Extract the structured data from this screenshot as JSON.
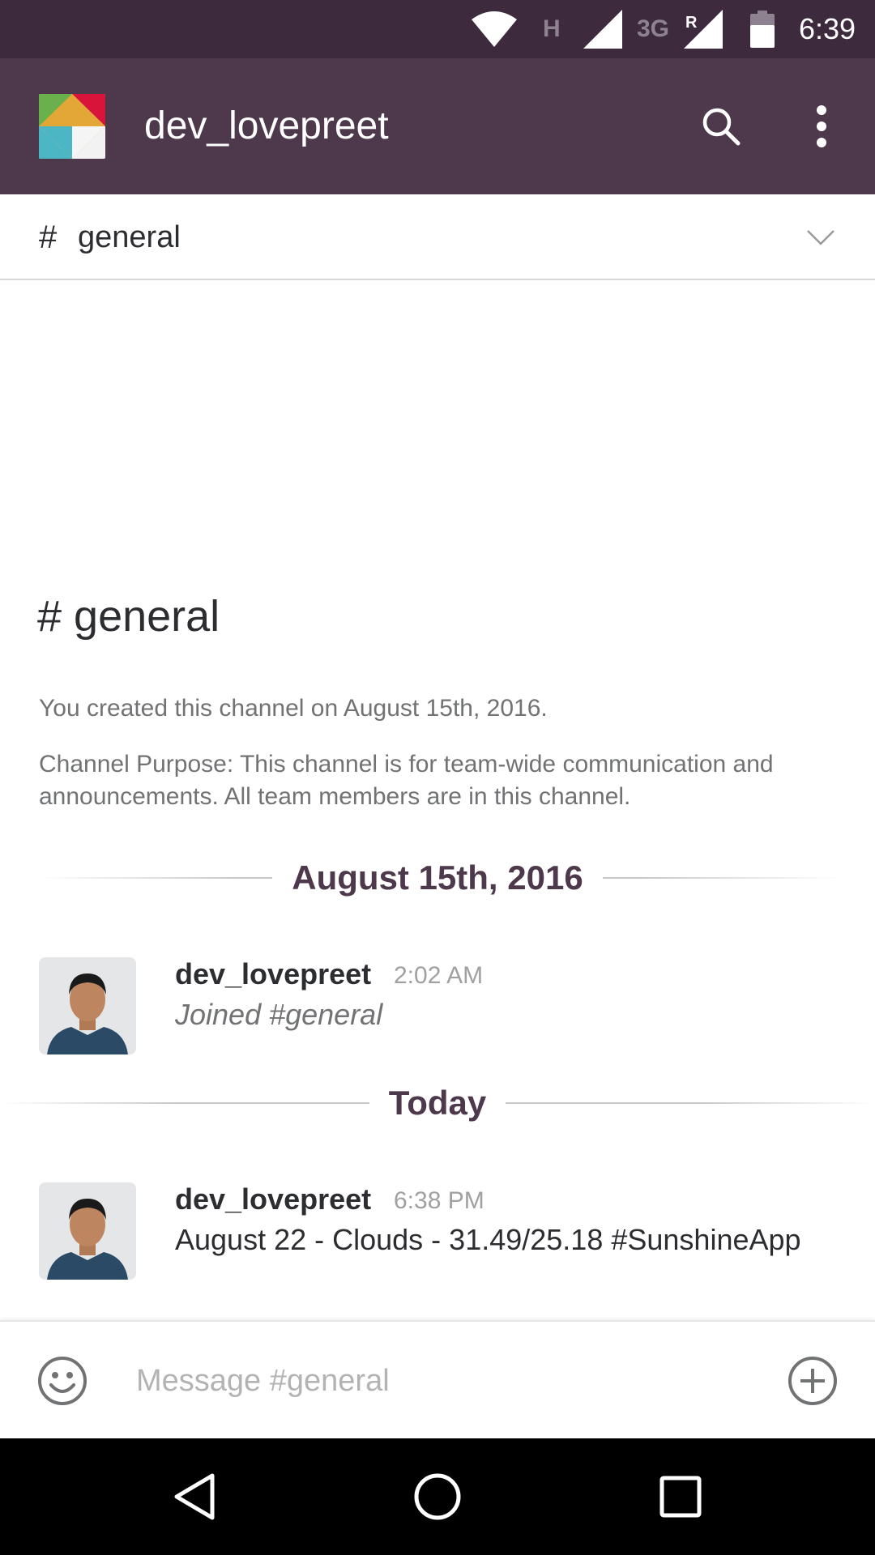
{
  "status_bar": {
    "network_h": "H",
    "network_3g": "3G",
    "roaming": "R",
    "time": "6:39",
    "icons": [
      "wifi-icon",
      "signal-icon",
      "roaming-signal-icon",
      "battery-icon"
    ]
  },
  "app_bar": {
    "team_name": "dev_lovepreet",
    "icons": [
      "team-logo",
      "search-icon",
      "overflow-menu-icon"
    ]
  },
  "channel_header": {
    "hash": "#",
    "name": "general",
    "icon": "chevron-down-icon"
  },
  "intro": {
    "title": "# general",
    "created": "You created this channel on August 15th, 2016.",
    "purpose": "Channel Purpose: This channel is for team-wide communication and announcements. All team members are in this channel."
  },
  "dividers": [
    {
      "label": "August 15th, 2016"
    },
    {
      "label": "Today"
    }
  ],
  "messages": [
    {
      "author": "dev_lovepreet",
      "time": "2:02 AM",
      "text": "Joined #general",
      "italic": true
    },
    {
      "author": "dev_lovepreet",
      "time": "6:38 PM",
      "text": "August 22 - Clouds - 31.49/25.18 #SunshineApp",
      "italic": false
    }
  ],
  "composer": {
    "placeholder": "Message #general",
    "icons": [
      "emoji-icon",
      "add-icon"
    ]
  },
  "nav_bar": {
    "icons": [
      "back-icon",
      "home-icon",
      "recents-icon"
    ]
  },
  "colors": {
    "status_bar": "#3d2b3d",
    "app_bar": "#4d394b",
    "divider_label": "#4d394b",
    "text": "#2c2d30",
    "muted": "#717274"
  }
}
